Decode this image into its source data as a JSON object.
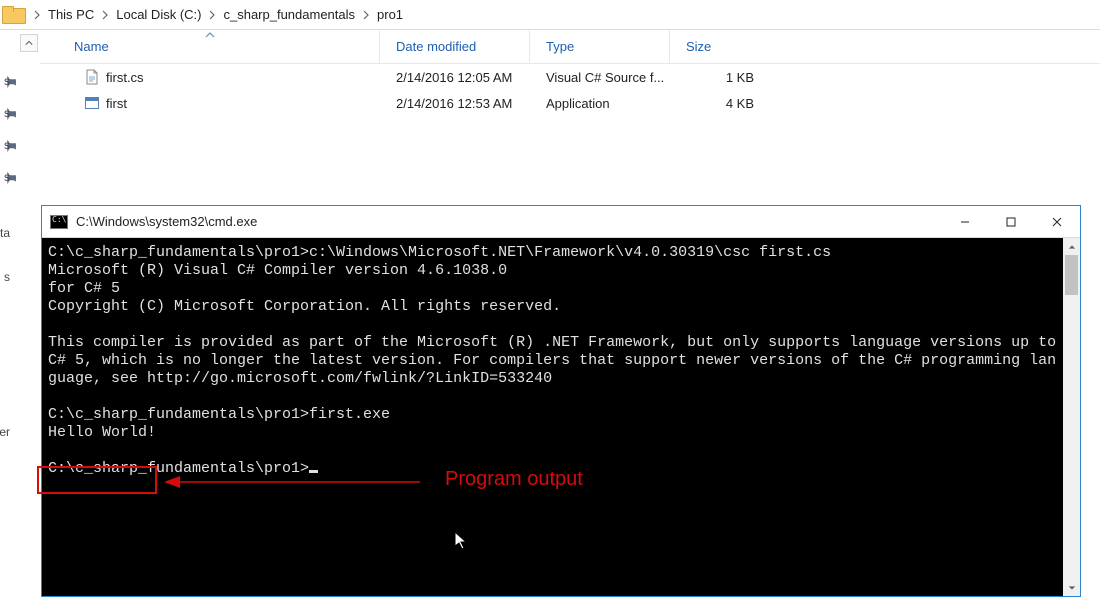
{
  "breadcrumb": {
    "segments": [
      "This PC",
      "Local Disk (C:)",
      "c_sharp_fundamentals",
      "pro1"
    ]
  },
  "quick_access": {
    "items": [
      "s",
      "s",
      "s",
      "s",
      "nenta",
      "s",
      "Higher"
    ]
  },
  "file_list": {
    "columns": {
      "name": "Name",
      "date": "Date modified",
      "type": "Type",
      "size": "Size"
    },
    "sorted_column": "name",
    "rows": [
      {
        "icon": "csfile",
        "name": "first.cs",
        "date": "2/14/2016 12:05 AM",
        "type": "Visual C# Source f...",
        "size": "1 KB"
      },
      {
        "icon": "exe",
        "name": "first",
        "date": "2/14/2016 12:53 AM",
        "type": "Application",
        "size": "4 KB"
      }
    ]
  },
  "cmd": {
    "title": "C:\\Windows\\system32\\cmd.exe",
    "lines": [
      "C:\\c_sharp_fundamentals\\pro1>c:\\Windows\\Microsoft.NET\\Framework\\v4.0.30319\\csc first.cs",
      "Microsoft (R) Visual C# Compiler version 4.6.1038.0",
      "for C# 5",
      "Copyright (C) Microsoft Corporation. All rights reserved.",
      "",
      "This compiler is provided as part of the Microsoft (R) .NET Framework, but only supports language versions up to C# 5, which is no longer the latest version. For compilers that support newer versions of the C# programming language, see http://go.microsoft.com/fwlink/?LinkID=533240",
      "",
      "C:\\c_sharp_fundamentals\\pro1>first.exe",
      "Hello World!",
      "",
      "C:\\c_sharp_fundamentals\\pro1>"
    ]
  },
  "annotation": {
    "label": "Program output"
  }
}
